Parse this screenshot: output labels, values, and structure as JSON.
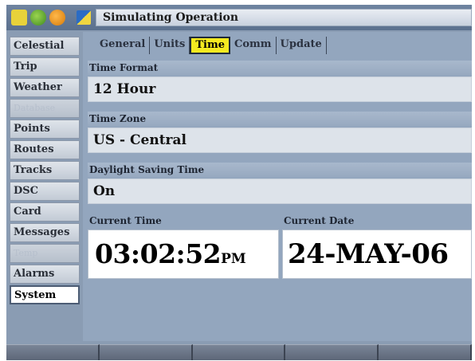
{
  "window": {
    "title": "Simulating Operation",
    "status_icons": [
      "gps-signal-icon",
      "satellite-icon",
      "battery-icon",
      "page-app-icon"
    ]
  },
  "sidebar": {
    "items": [
      {
        "label": "Celestial",
        "state": "normal"
      },
      {
        "label": "Trip",
        "state": "normal"
      },
      {
        "label": "Weather",
        "state": "normal"
      },
      {
        "label": "Database",
        "state": "dim"
      },
      {
        "label": "Points",
        "state": "normal"
      },
      {
        "label": "Routes",
        "state": "normal"
      },
      {
        "label": "Tracks",
        "state": "normal"
      },
      {
        "label": "DSC",
        "state": "normal"
      },
      {
        "label": "Card",
        "state": "normal"
      },
      {
        "label": "Messages",
        "state": "normal"
      },
      {
        "label": "Temp",
        "state": "dim"
      },
      {
        "label": "Alarms",
        "state": "normal"
      },
      {
        "label": "System",
        "state": "selected"
      }
    ]
  },
  "tabs": [
    {
      "label": "General",
      "active": false
    },
    {
      "label": "Units",
      "active": false
    },
    {
      "label": "Time",
      "active": true
    },
    {
      "label": "Comm",
      "active": false
    },
    {
      "label": "Update",
      "active": false
    }
  ],
  "settings": {
    "time_format": {
      "label": "Time Format",
      "value": "12 Hour"
    },
    "time_zone": {
      "label": "Time Zone",
      "value": "US - Central"
    },
    "daylight_saving": {
      "label": "Daylight Saving Time",
      "value": "On"
    }
  },
  "current": {
    "time_label": "Current Time",
    "time_value": "03:02:52",
    "time_ampm": "PM",
    "date_label": "Current Date",
    "date_value": "24-MAY-06"
  },
  "colors": {
    "active_tab": "#f5ea20",
    "panel_bg": "#93a6be",
    "field_bg": "#dde3ea"
  }
}
